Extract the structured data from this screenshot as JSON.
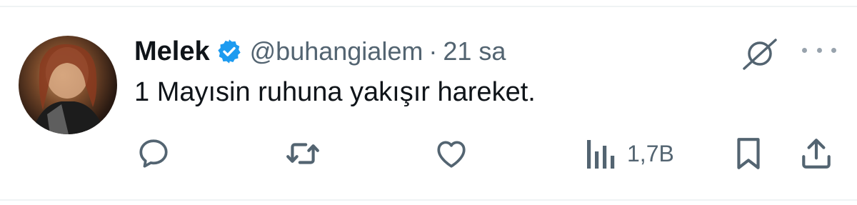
{
  "tweet": {
    "author_name": "Melek",
    "handle": "@buhangialem",
    "separator": "·",
    "time": "21 sa",
    "text": "1 Mayısin ruhuna yakışır hareket.",
    "verified": true
  },
  "actions": {
    "views": "1,7B"
  },
  "icons": {
    "reply": "reply-icon",
    "retweet": "retweet-icon",
    "like": "like-icon",
    "views": "views-icon",
    "bookmark": "bookmark-icon",
    "share": "share-icon",
    "grok": "grok-icon",
    "more": "more-icon",
    "verified": "verified-badge-icon"
  },
  "colors": {
    "text": "#0f1419",
    "secondary": "#536471",
    "verified": "#1d9bf0",
    "divider": "#eff3f4"
  }
}
